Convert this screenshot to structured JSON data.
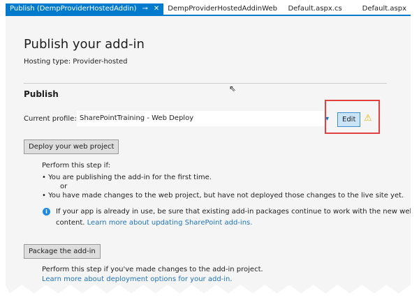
{
  "tabs": [
    {
      "label": "Publish (DempProviderHostedAddin)",
      "active": true
    },
    {
      "label": "DempProviderHostedAddinWeb"
    },
    {
      "label": "Default.aspx.cs"
    },
    {
      "label": "Default.aspx"
    }
  ],
  "tab_icons": {
    "pin": "⊸",
    "close": "✕"
  },
  "page": {
    "title": "Publish your add-in",
    "hosting": "Hosting type: Provider-hosted",
    "section": "Publish"
  },
  "profile": {
    "label": "Current profile:",
    "value": "SharePointTraining - Web Deploy",
    "edit": "Edit",
    "warning_icon": "warning-icon"
  },
  "deploy": {
    "button": "Deploy your web project",
    "intro": "Perform this step if:",
    "bullet1": "You are publishing the add-in for the first time.",
    "or": "or",
    "bullet2": "You have made changes to the web project, but have not deployed those changes to the live site yet.",
    "info1": "If your app is already in use, be sure that existing add-in packages continue to work with the new web",
    "info2": "content.",
    "info_link": "Learn more about updating SharePoint add-ins."
  },
  "package": {
    "button": "Package the add-in",
    "text": "Perform this step if you've made changes to the add-in project.",
    "link": "Learn more about deployment options for your add-in."
  },
  "colors": {
    "accent": "#007acc",
    "highlight": "#e04040",
    "link": "#1e73be"
  }
}
